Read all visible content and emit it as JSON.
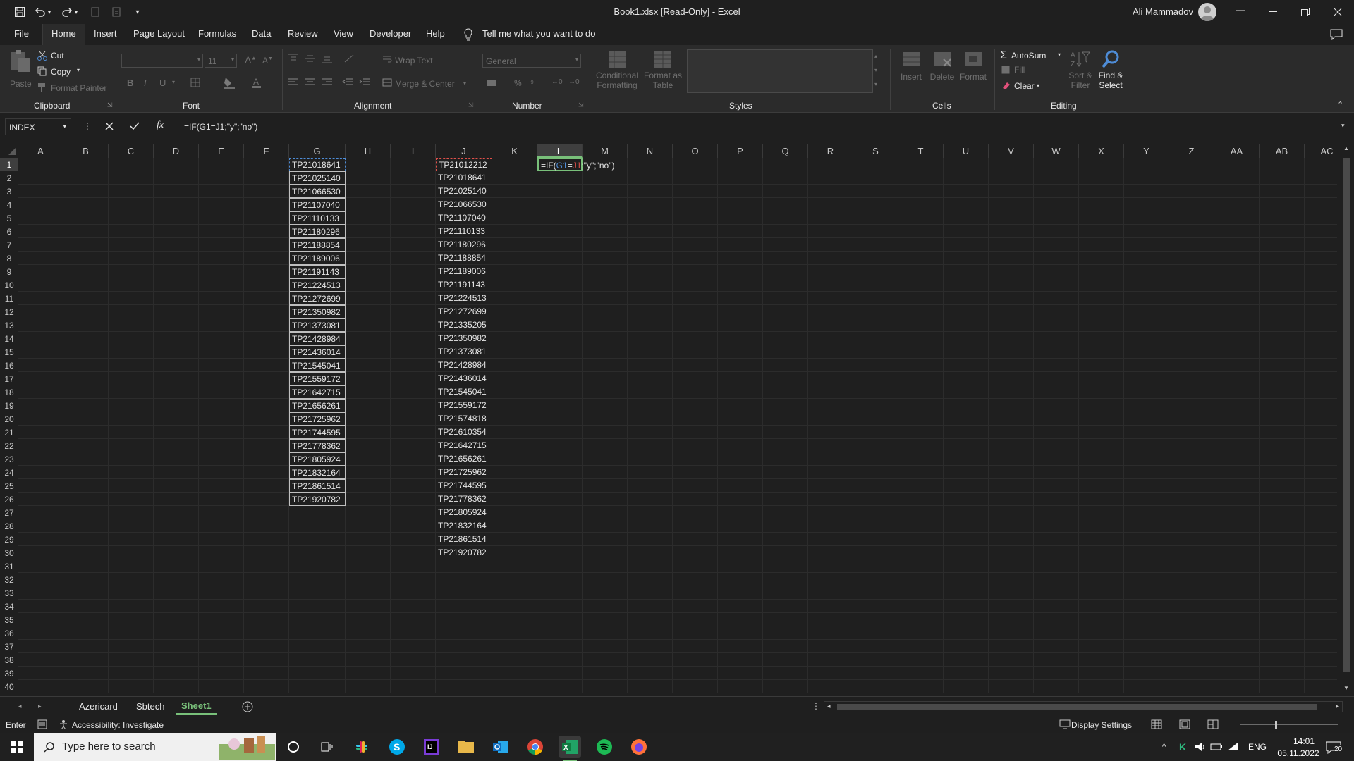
{
  "window": {
    "title": "Book1.xlsx  [Read-Only]  -  Excel",
    "user": "Ali Mammadov"
  },
  "tabs": [
    "File",
    "Home",
    "Insert",
    "Page Layout",
    "Formulas",
    "Data",
    "Review",
    "View",
    "Developer",
    "Help"
  ],
  "tell_me": "Tell me what you want to do",
  "ribbon": {
    "clipboard": {
      "paste": "Paste",
      "cut": "Cut",
      "copy": "Copy",
      "format_painter": "Format Painter",
      "label": "Clipboard"
    },
    "font": {
      "name": "",
      "size": "11",
      "label": "Font"
    },
    "alignment": {
      "wrap": "Wrap Text",
      "merge": "Merge & Center",
      "label": "Alignment"
    },
    "number": {
      "format": "General",
      "label": "Number"
    },
    "styles": {
      "conditional": "Conditional Formatting",
      "format_table": "Format as Table",
      "label": "Styles"
    },
    "cells": {
      "insert": "Insert",
      "delete": "Delete",
      "format": "Format",
      "label": "Cells"
    },
    "editing": {
      "autosum": "AutoSum",
      "fill": "Fill",
      "clear": "Clear",
      "sort": "Sort & Filter",
      "find": "Find & Select",
      "label": "Editing"
    }
  },
  "formula_bar": {
    "name_box": "INDEX",
    "formula": "=IF(G1=J1;\"y\";\"no\")"
  },
  "columns": [
    "A",
    "B",
    "C",
    "D",
    "E",
    "F",
    "G",
    "H",
    "I",
    "J",
    "K",
    "L",
    "M",
    "N",
    "O",
    "P",
    "Q",
    "R",
    "S",
    "T",
    "U",
    "V",
    "W",
    "X",
    "Y",
    "Z",
    "AA",
    "AB",
    "AC"
  ],
  "rows": [
    "1",
    "2",
    "3",
    "4",
    "5",
    "6",
    "7",
    "8",
    "9",
    "10",
    "11",
    "12",
    "13",
    "14",
    "15",
    "16",
    "17",
    "18",
    "19",
    "20",
    "21",
    "22",
    "23",
    "24",
    "25",
    "26",
    "27",
    "28",
    "29",
    "30",
    "31",
    "32",
    "33",
    "34",
    "35",
    "36",
    "37",
    "38",
    "39",
    "40"
  ],
  "col_g": [
    "TP21018641",
    "TP21025140",
    "TP21066530",
    "TP21107040",
    "TP21110133",
    "TP21180296",
    "TP21188854",
    "TP21189006",
    "TP21191143",
    "TP21224513",
    "TP21272699",
    "TP21350982",
    "TP21373081",
    "TP21428984",
    "TP21436014",
    "TP21545041",
    "TP21559172",
    "TP21642715",
    "TP21656261",
    "TP21725962",
    "TP21744595",
    "TP21778362",
    "TP21805924",
    "TP21832164",
    "TP21861514",
    "TP21920782"
  ],
  "col_j": [
    "TP21012212",
    "TP21018641",
    "TP21025140",
    "TP21066530",
    "TP21107040",
    "TP21110133",
    "TP21180296",
    "TP21188854",
    "TP21189006",
    "TP21191143",
    "TP21224513",
    "TP21272699",
    "TP21335205",
    "TP21350982",
    "TP21373081",
    "TP21428984",
    "TP21436014",
    "TP21545041",
    "TP21559172",
    "TP21574818",
    "TP21610354",
    "TP21642715",
    "TP21656261",
    "TP21725962",
    "TP21744595",
    "TP21778362",
    "TP21805924",
    "TP21832164",
    "TP21861514",
    "TP21920782"
  ],
  "edit_cell": {
    "prefix": "=IF(",
    "ref1": "G1",
    "eq": "=",
    "ref2": "J1",
    "suffix": ";\"y\";\"no\")"
  },
  "sheets": [
    "Azericard",
    "Sbtech",
    "Sheet1"
  ],
  "status": {
    "mode": "Enter",
    "accessibility": "Accessibility: Investigate",
    "display_settings": "Display Settings"
  },
  "taskbar": {
    "search_placeholder": "Type here to search",
    "lang": "ENG",
    "time": "14:01",
    "date": "05.11.2022",
    "notif": "20"
  },
  "colors": {
    "accent_green": "#79c07a",
    "ref_blue": "#4e8cd6",
    "ref_red": "#e0504a"
  }
}
